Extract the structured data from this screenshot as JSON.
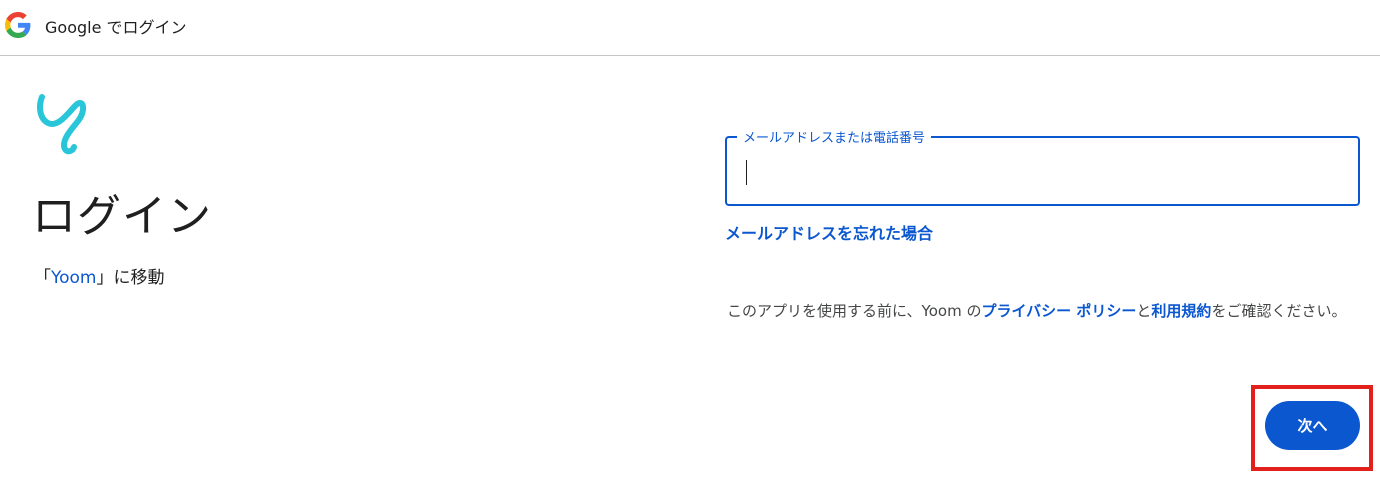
{
  "topbar": {
    "title": "Google でログイン",
    "logo_icon": "google-g-icon"
  },
  "main": {
    "app_logo_icon": "yoom-logo-icon",
    "heading": "ログイン",
    "subtitle_prefix": "「",
    "app_name": "Yoom",
    "subtitle_suffix": "」に移動"
  },
  "form": {
    "email_label": "メールアドレスまたは電話番号",
    "email_value": "",
    "forgot_email_link": "メールアドレスを忘れた場合"
  },
  "notice": {
    "text_before": "このアプリを使用する前に、Yoom の",
    "privacy_link": "プライバシー ポリシー",
    "text_middle": "と",
    "terms_link": "利用規約",
    "text_after": "をご確認ください。"
  },
  "actions": {
    "next_label": "次へ"
  },
  "colors": {
    "accent": "#0b57d0",
    "highlight": "#e3201b",
    "yoom_logo": "#29c6d9"
  }
}
